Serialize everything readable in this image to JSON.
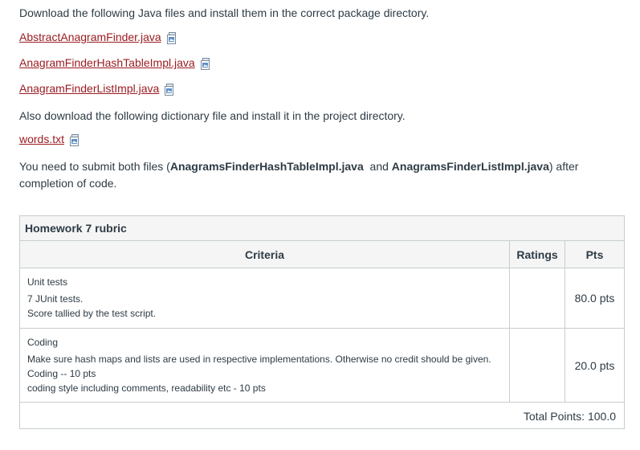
{
  "intro": "Download the following Java files and install them in the correct package directory.",
  "files": [
    {
      "name": "AbstractAnagramFinder.java"
    },
    {
      "name": "AnagramFinderHashTableImpl.java"
    },
    {
      "name": "AnagramFinderListImpl.java"
    }
  ],
  "also_text": "Also download the following dictionary file and install it in the project directory.",
  "dictionary_file": {
    "name": "words.txt"
  },
  "submit": {
    "prefix": "You need to submit both files (",
    "file1": "AnagramsFinderHashTableImpl.java",
    "middle": "  and ",
    "file2": "AnagramsFinderListImpl.java",
    "suffix": ") after completion of code."
  },
  "rubric": {
    "title": "Homework 7 rubric",
    "headers": {
      "criteria": "Criteria",
      "ratings": "Ratings",
      "pts": "Pts"
    },
    "rows": [
      {
        "name": "Unit tests",
        "lines": [
          "7 JUnit tests.",
          "Score tallied by the test script."
        ],
        "pts": "80.0 pts"
      },
      {
        "name": "Coding",
        "lines": [
          "Make sure hash maps and lists are used in respective implementations. Otherwise no credit should be given.",
          "Coding -- 10 pts",
          "coding style including comments, readability etc - 10 pts"
        ],
        "pts": "20.0 pts"
      }
    ],
    "total": "Total Points: 100.0"
  },
  "colors": {
    "link": "#9b1c22",
    "text": "#2d3b45",
    "border": "#c7cdd1",
    "header_bg": "#f5f5f5"
  },
  "icons": {
    "file_preview": "file-preview-icon"
  }
}
